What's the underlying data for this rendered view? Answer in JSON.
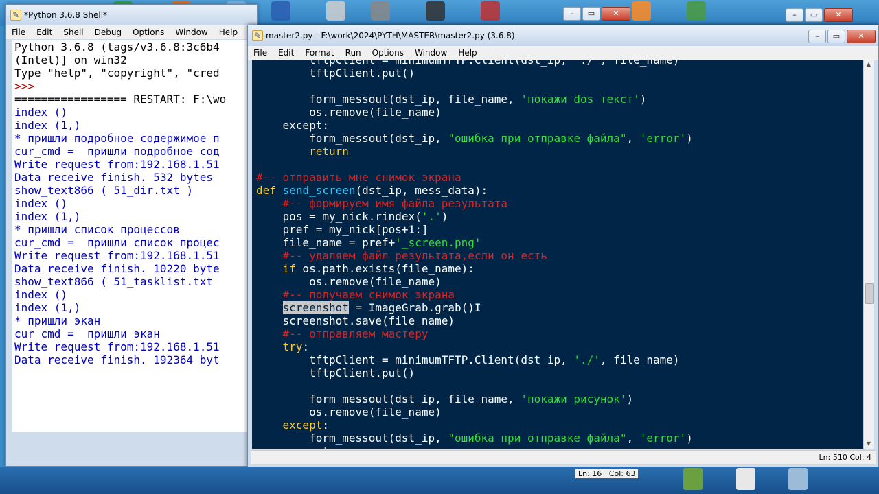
{
  "shell": {
    "title": "*Python 3.6.8 Shell*",
    "menu": [
      "File",
      "Edit",
      "Shell",
      "Debug",
      "Options",
      "Window",
      "Help"
    ],
    "lines": [
      {
        "t": "Python 3.6.8 (tags/v3.6.8:3c6b4",
        "c": "banner"
      },
      {
        "t": "(Intel)] on win32",
        "c": "banner"
      },
      {
        "t": "Type \"help\", \"copyright\", \"cred",
        "c": "banner"
      },
      {
        "t": ">>> ",
        "c": "prompt"
      },
      {
        "t": "================= RESTART: F:\\wo",
        "c": "banner"
      },
      {
        "t": "index ()",
        "c": "stdout"
      },
      {
        "t": "index (1,)",
        "c": "stdout"
      },
      {
        "t": "* пришли подробное содержимое п",
        "c": "stdout"
      },
      {
        "t": "cur_cmd =  пришли подробное сод",
        "c": "stdout"
      },
      {
        "t": "Write request from:192.168.1.51",
        "c": "stdout"
      },
      {
        "t": "Data receive finish. 532 bytes",
        "c": "stdout"
      },
      {
        "t": "show_text866 ( 51_dir.txt )",
        "c": "stdout"
      },
      {
        "t": "index ()",
        "c": "stdout"
      },
      {
        "t": "index (1,)",
        "c": "stdout"
      },
      {
        "t": "* пришли список процессов",
        "c": "stdout"
      },
      {
        "t": "cur_cmd =  пришли список процес",
        "c": "stdout"
      },
      {
        "t": "Write request from:192.168.1.51",
        "c": "stdout"
      },
      {
        "t": "Data receive finish. 10220 byte",
        "c": "stdout"
      },
      {
        "t": "show_text866 ( 51_tasklist.txt",
        "c": "stdout"
      },
      {
        "t": "index ()",
        "c": "stdout"
      },
      {
        "t": "index (1,)",
        "c": "stdout"
      },
      {
        "t": "* пришли экан",
        "c": "stdout"
      },
      {
        "t": "cur_cmd =  пришли экан",
        "c": "stdout"
      },
      {
        "t": "Write request from:192.168.1.51",
        "c": "stdout"
      },
      {
        "t": "Data receive finish. 192364 byt",
        "c": "stdout"
      }
    ],
    "status": "Ln: 16   Col: 63"
  },
  "editor": {
    "title": "master2.py - F:\\work\\2024\\PYTH\\MASTER\\master2.py (3.6.8)",
    "menu": [
      "File",
      "Edit",
      "Format",
      "Run",
      "Options",
      "Window",
      "Help"
    ],
    "status": "Ln: 510   Col: 4",
    "code": [
      [
        [
          "        tftpClient = minimumTFTP.Client(dst_ip, './', file_name)",
          ""
        ]
      ],
      [
        [
          "        tftpClient.put()",
          ""
        ]
      ],
      [
        [
          "",
          ""
        ]
      ],
      [
        [
          "        form_messout(dst_ip, file_name, ",
          ""
        ],
        [
          "'покажи dos текст'",
          "str"
        ],
        [
          ")",
          ""
        ]
      ],
      [
        [
          "        os.remove(file_name)",
          ""
        ]
      ],
      [
        [
          "    ",
          ""
        ],
        [
          "except",
          ""
        ],
        [
          ":",
          ""
        ]
      ],
      [
        [
          "        form_messout(dst_ip, ",
          ""
        ],
        [
          "\"ошибка при отправке файла\"",
          "str"
        ],
        [
          ", ",
          ""
        ],
        [
          "'error'",
          "str"
        ],
        [
          ")",
          ""
        ]
      ],
      [
        [
          "        ",
          ""
        ],
        [
          "return",
          "kw"
        ]
      ],
      [
        [
          "",
          ""
        ]
      ],
      [
        [
          "#-- отправить мне снимок экрана",
          "cmt"
        ]
      ],
      [
        [
          "def",
          "kw"
        ],
        [
          " ",
          ""
        ],
        [
          "send_screen",
          "fn"
        ],
        [
          "(dst_ip, mess_data):",
          ""
        ]
      ],
      [
        [
          "    ",
          ""
        ],
        [
          "#-- формируем имя файла результата",
          "cmt"
        ]
      ],
      [
        [
          "    pos = my_nick.rindex(",
          ""
        ],
        [
          "'.'",
          "str"
        ],
        [
          ")",
          ""
        ]
      ],
      [
        [
          "    pref = my_nick[pos+1:]",
          ""
        ]
      ],
      [
        [
          "    file_name = pref+",
          ""
        ],
        [
          "'_screen.png'",
          "str"
        ]
      ],
      [
        [
          "    ",
          ""
        ],
        [
          "#-- удаляем файл результата,если он есть",
          "cmt"
        ]
      ],
      [
        [
          "    ",
          ""
        ],
        [
          "if",
          "kw"
        ],
        [
          " os.path.exists(file_name):",
          ""
        ]
      ],
      [
        [
          "        os.remove(file_name)",
          ""
        ]
      ],
      [
        [
          "    ",
          ""
        ],
        [
          "#-- получаем снимок экрана",
          "cmt"
        ]
      ],
      [
        [
          "    ",
          ""
        ],
        [
          "screenshot",
          "sel"
        ],
        [
          " = ImageGrab.grab()",
          ""
        ],
        [
          "I",
          "cursor-i"
        ]
      ],
      [
        [
          "    screenshot.save(file_name)",
          ""
        ]
      ],
      [
        [
          "    ",
          ""
        ],
        [
          "#-- отправляем мастеру",
          "cmt"
        ]
      ],
      [
        [
          "    ",
          ""
        ],
        [
          "try",
          "kw"
        ],
        [
          ":",
          ""
        ]
      ],
      [
        [
          "        tftpClient = minimumTFTP.Client(dst_ip, ",
          ""
        ],
        [
          "'./'",
          "str"
        ],
        [
          ", file_name)",
          ""
        ]
      ],
      [
        [
          "        tftpClient.put()",
          ""
        ]
      ],
      [
        [
          "",
          ""
        ]
      ],
      [
        [
          "        form_messout(dst_ip, file_name, ",
          ""
        ],
        [
          "'покажи рисунок'",
          "str"
        ],
        [
          ")",
          ""
        ]
      ],
      [
        [
          "        os.remove(file_name)",
          ""
        ]
      ],
      [
        [
          "    ",
          ""
        ],
        [
          "except",
          "kw"
        ],
        [
          ":",
          ""
        ]
      ],
      [
        [
          "        form_messout(dst_ip, ",
          ""
        ],
        [
          "\"ошибка при отправке файла\"",
          "str"
        ],
        [
          ", ",
          ""
        ],
        [
          "'error'",
          "str"
        ],
        [
          ")",
          ""
        ]
      ],
      [
        [
          "        ",
          ""
        ],
        [
          "return",
          "kw"
        ]
      ]
    ]
  },
  "colors": {
    "editor_bg": "#002546",
    "keyword": "#ffcc33",
    "function": "#33ccff",
    "string": "#33dd33",
    "comment": "#dd2222"
  }
}
